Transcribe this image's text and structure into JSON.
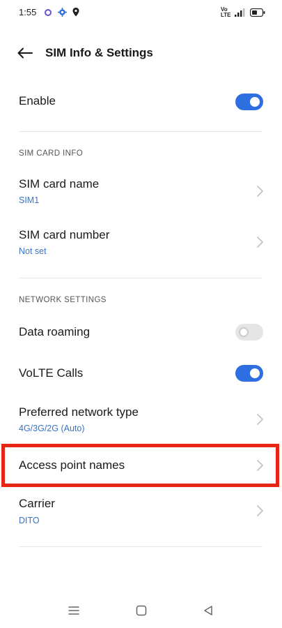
{
  "status_bar": {
    "time": "1:55",
    "network_label": "Vo LTE"
  },
  "header": {
    "title": "SIM Info & Settings"
  },
  "enable_row": {
    "label": "Enable",
    "toggle_on": true
  },
  "sim_card_info": {
    "section_label": "SIM CARD INFO",
    "items": [
      {
        "label": "SIM card name",
        "value": "SIM1"
      },
      {
        "label": "SIM card number",
        "value": "Not set"
      }
    ]
  },
  "network_settings": {
    "section_label": "NETWORK SETTINGS",
    "data_roaming": {
      "label": "Data roaming",
      "toggle_on": false
    },
    "volte": {
      "label": "VoLTE Calls",
      "toggle_on": true
    },
    "preferred_network": {
      "label": "Preferred network type",
      "value": "4G/3G/2G (Auto)"
    },
    "apn": {
      "label": "Access point names"
    },
    "carrier": {
      "label": "Carrier",
      "value": "DITO"
    }
  },
  "colors": {
    "accent": "#2d6fe0",
    "subtitle": "#3b73c4",
    "highlight": "#e62612"
  }
}
